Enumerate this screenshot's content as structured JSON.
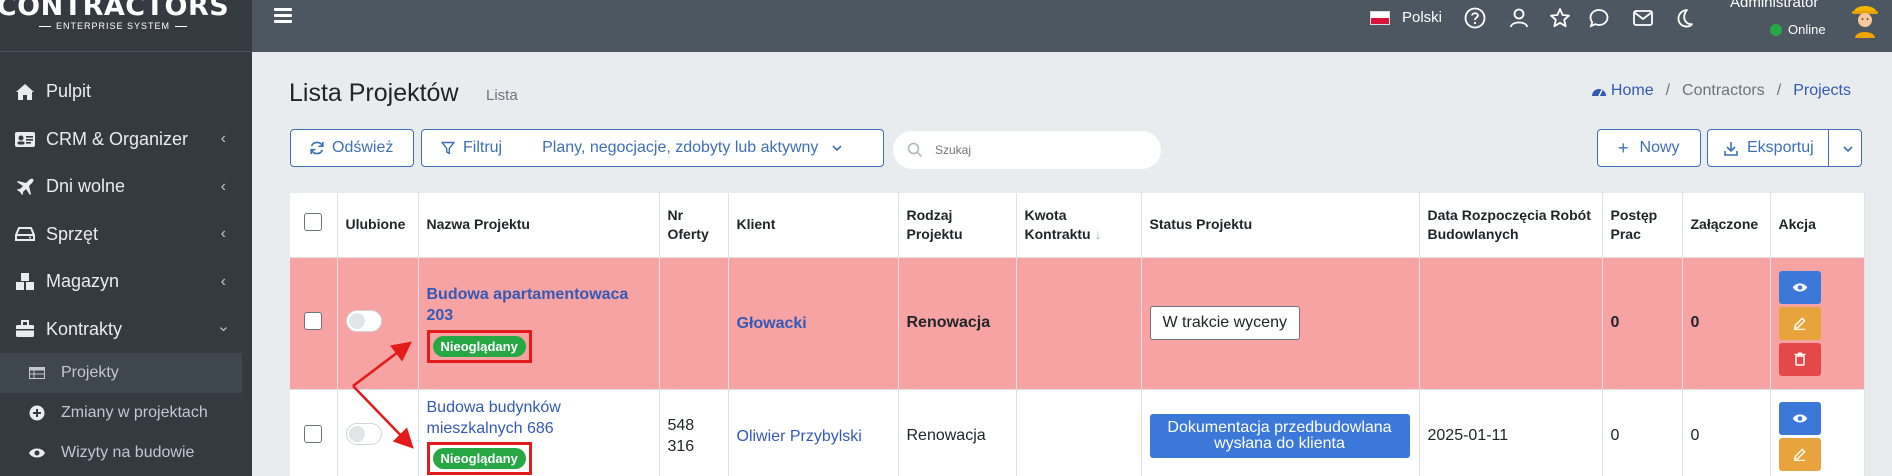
{
  "brand": {
    "title": "CONTRACTORS",
    "subtitle": "ENTERPRISE SYSTEM"
  },
  "sidebar": {
    "items": [
      {
        "label": "Pulpit",
        "icon": "home-icon",
        "has_chevron": false
      },
      {
        "label": "CRM & Organizer",
        "icon": "address-card-icon",
        "has_chevron": true
      },
      {
        "label": "Dni wolne",
        "icon": "plane-icon",
        "has_chevron": true
      },
      {
        "label": "Sprzęt",
        "icon": "hdd-icon",
        "has_chevron": true
      },
      {
        "label": "Magazyn",
        "icon": "cubes-icon",
        "has_chevron": true
      },
      {
        "label": "Kontrakty",
        "icon": "briefcase-icon",
        "has_chevron": true,
        "expanded": true
      }
    ],
    "sub_items": [
      {
        "label": "Projekty",
        "icon": "list-icon",
        "active": true
      },
      {
        "label": "Zmiany w projektach",
        "icon": "plus-circle-icon",
        "active": false
      },
      {
        "label": "Wizyty na budowie",
        "icon": "eye-icon",
        "active": false
      }
    ]
  },
  "topbar": {
    "language": "Polski",
    "user_name": "Administrator",
    "user_status": "Online",
    "icons": [
      "question-circle-icon",
      "user-icon",
      "star-icon",
      "comment-icon",
      "envelope-icon",
      "moon-icon"
    ]
  },
  "page": {
    "title": "Lista Projektów",
    "subtitle": "Lista",
    "breadcrumb": [
      "Home",
      "Contractors",
      "Projects"
    ]
  },
  "toolbar": {
    "refresh_label": "Odśwież",
    "filter_label": "Filtruj",
    "filter_value": "Plany, negocjacje, zdobyty lub aktywny",
    "search_placeholder": "Szukaj",
    "new_label": "Nowy",
    "export_label": "Eksportuj"
  },
  "table": {
    "headers": {
      "favorite": "Ulubione",
      "name": "Nazwa Projektu",
      "offer_no": "Nr Oferty",
      "client": "Klient",
      "type": "Rodzaj Projektu",
      "amount": "Kwota Kontraktu",
      "status": "Status Projektu",
      "start_date": "Data Rozpoczęcia Robót Budowlanych",
      "progress": "Postęp Prac",
      "attached": "Załączone",
      "action": "Akcja"
    },
    "rows": [
      {
        "name": "Budowa apartamentowaca 203",
        "badge": "Nieoglądany",
        "offer_no": "",
        "client": "Głowacki",
        "type": "Renowacja",
        "amount": "",
        "status": "W trakcie wyceny",
        "start_date": "",
        "progress": "0",
        "attached": "0"
      },
      {
        "name": "Budowa budynków mieszkalnych 686",
        "badge": "Nieoglądany",
        "offer_no": "548 316",
        "client": "Oliwier Przybylski",
        "type": "Renowacja",
        "amount": "",
        "status": "Dokumentacja przedbudowlana wysłana do klienta",
        "start_date": "2025-01-11",
        "progress": "0",
        "attached": "0"
      }
    ]
  },
  "colors": {
    "sidebar": "#343a40",
    "topbar": "#4d5761",
    "accent": "#3c78d8",
    "highlight_row": "#f8a3a3",
    "badge": "#28a745",
    "annotation": "#e31b1b"
  }
}
